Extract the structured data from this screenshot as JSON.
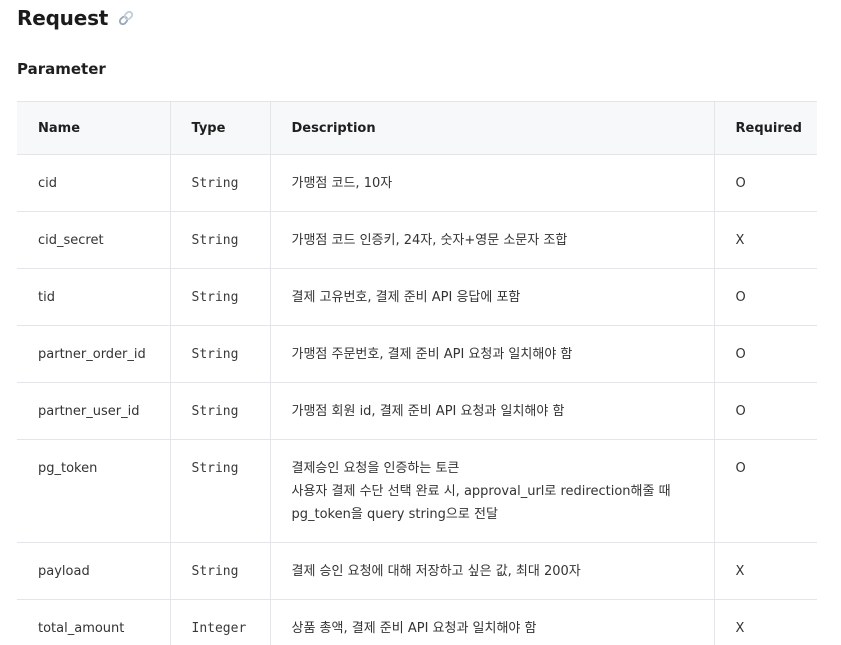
{
  "header": {
    "title": "Request",
    "link_icon": "link-icon"
  },
  "section": {
    "title": "Parameter"
  },
  "table": {
    "columns": [
      "Name",
      "Type",
      "Description",
      "Required"
    ],
    "rows": [
      {
        "name": "cid",
        "type": "String",
        "description": [
          "가맹점 코드, 10자"
        ],
        "required": "O"
      },
      {
        "name": "cid_secret",
        "type": "String",
        "description": [
          "가맹점 코드 인증키, 24자, 숫자+영문 소문자 조합"
        ],
        "required": "X"
      },
      {
        "name": "tid",
        "type": "String",
        "description": [
          "결제 고유번호, 결제 준비 API 응답에 포함"
        ],
        "required": "O"
      },
      {
        "name": "partner_order_id",
        "type": "String",
        "description": [
          "가맹점 주문번호, 결제 준비 API 요청과 일치해야 함"
        ],
        "required": "O"
      },
      {
        "name": "partner_user_id",
        "type": "String",
        "description": [
          "가맹점 회원 id, 결제 준비 API 요청과 일치해야 함"
        ],
        "required": "O"
      },
      {
        "name": "pg_token",
        "type": "String",
        "description": [
          "결제승인 요청을 인증하는 토큰",
          "사용자 결제 수단 선택 완료 시, approval_url로 redirection해줄 때",
          "pg_token을 query string으로 전달"
        ],
        "required": "O"
      },
      {
        "name": "payload",
        "type": "String",
        "description": [
          "결제 승인 요청에 대해 저장하고 싶은 값, 최대 200자"
        ],
        "required": "X"
      },
      {
        "name": "total_amount",
        "type": "Integer",
        "description": [
          "상품 총액, 결제 준비 API 요청과 일치해야 함"
        ],
        "required": "X"
      }
    ]
  }
}
